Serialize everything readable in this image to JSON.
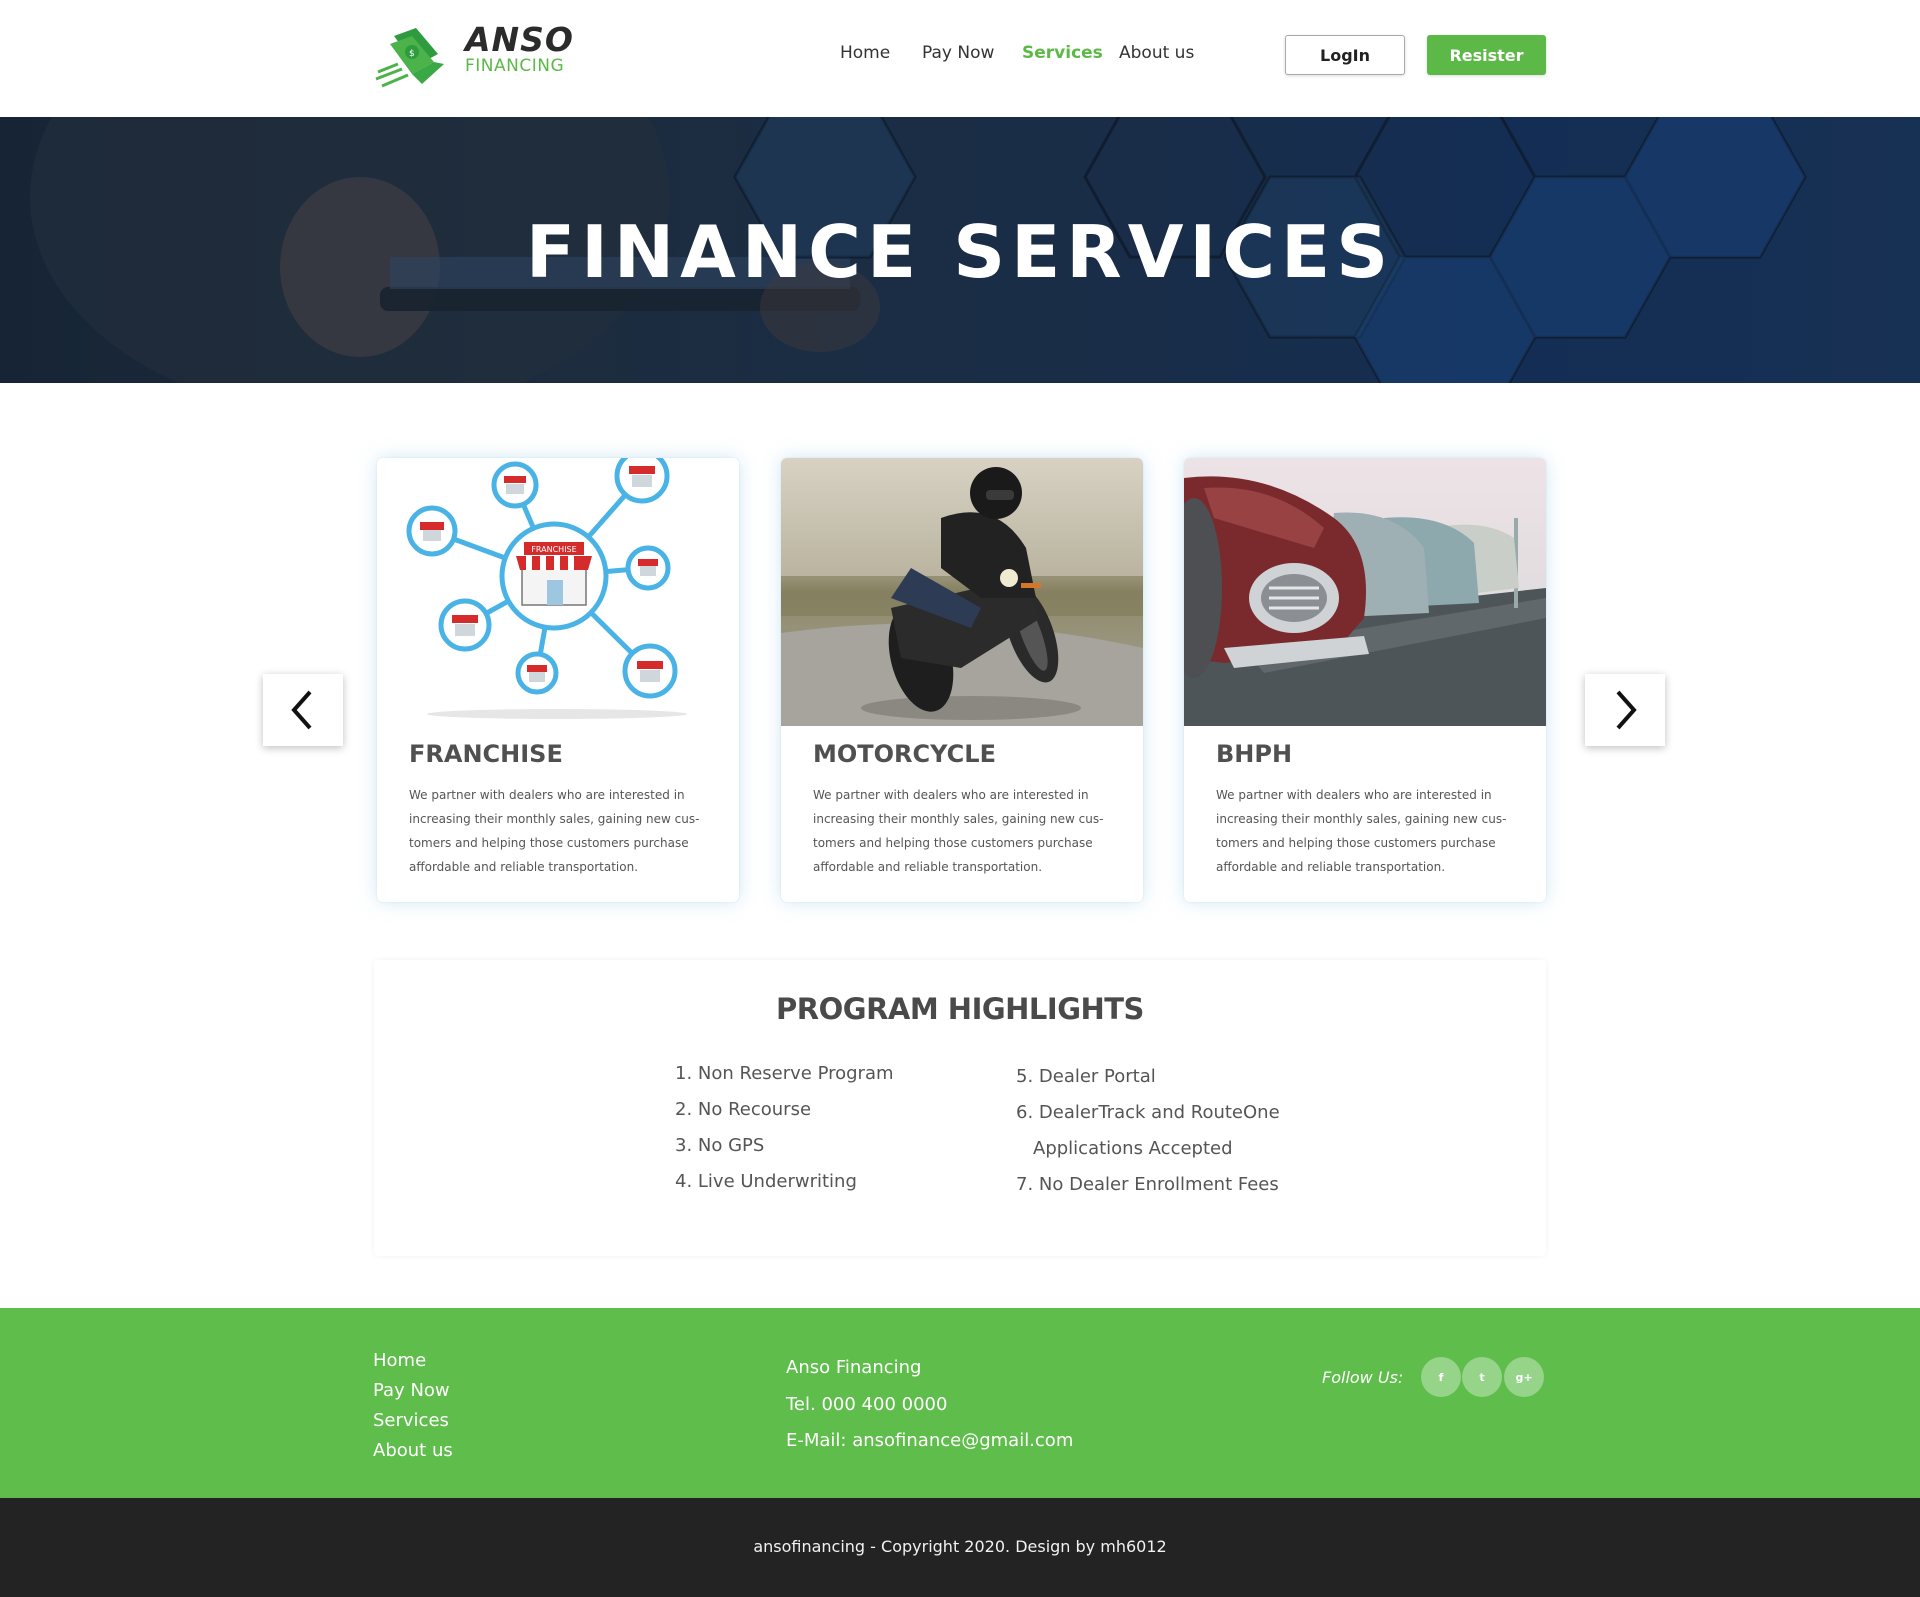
{
  "header": {
    "logo": {
      "name": "ANSO",
      "subtitle": "FINANCING"
    },
    "nav": [
      "Home",
      "Pay Now",
      "Services",
      "About us"
    ],
    "active_nav": "Services",
    "login_label": "LogIn",
    "register_label": "Resister"
  },
  "hero": {
    "title": "FINANCE SERVICES"
  },
  "carousel": {
    "cards": [
      {
        "title": "FRANCHISE",
        "image_label": "FRANCHISE",
        "text": "We partner with dealers who are interested in increasing their monthly sales, gaining new cus-tomers and helping those customers purchase affordable and reliable transportation."
      },
      {
        "title": "MOTORCYCLE",
        "text": "We partner with dealers who are interested in increasing their monthly sales, gaining new cus-tomers and helping those customers purchase affordable and reliable transportation."
      },
      {
        "title": "BHPH",
        "text": "We partner with dealers who are interested in increasing their monthly sales, gaining new cus-tomers and helping those customers purchase affordable and reliable transportation."
      }
    ],
    "prev_icon": "chevron-left-icon",
    "next_icon": "chevron-right-icon"
  },
  "highlights": {
    "title": "PROGRAM HIGHLIGHTS",
    "left": [
      "1. Non Reserve Program",
      "2. No Recourse",
      "3. No GPS",
      "4. Live Underwriting"
    ],
    "right": [
      "5. Dealer Portal",
      "6. DealerTrack and RouteOne",
      "Applications Accepted",
      "7. No Dealer Enrollment Fees"
    ]
  },
  "footer": {
    "links": [
      "Home",
      "Pay Now",
      "Services",
      "About us"
    ],
    "company": "Anso Financing",
    "tel": "Tel. 000 400 0000",
    "email": "E-Mail: ansofinance@gmail.com",
    "follow_label": "Follow Us:",
    "social": [
      {
        "icon": "facebook-icon",
        "glyph": "f"
      },
      {
        "icon": "twitter-icon",
        "glyph": "t"
      },
      {
        "icon": "google-plus-icon",
        "glyph": "g+"
      }
    ],
    "copyright": "ansofinancing - Copyright 2020. Design by mh6012"
  },
  "colors": {
    "brand_green": "#5cb947",
    "footer_dark": "#232323"
  }
}
